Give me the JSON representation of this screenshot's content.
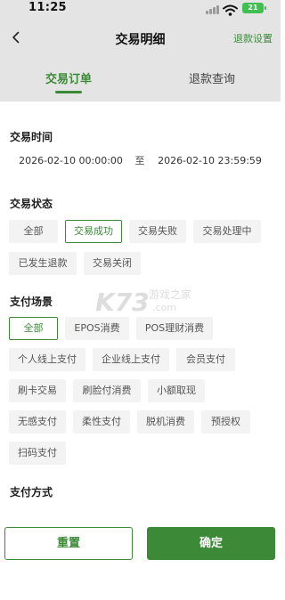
{
  "status_bar": {
    "time": "11:25",
    "battery": "21",
    "battery_color": "#3fbf4f"
  },
  "nav": {
    "title": "交易明细",
    "action_label": "退款设置",
    "back_icon": "chevron-left-icon"
  },
  "tabs": [
    {
      "label": "交易订单",
      "selected": true
    },
    {
      "label": "退款查询",
      "selected": false
    }
  ],
  "filter": {
    "time": {
      "title": "交易时间",
      "start": "2026-02-10 00:00:00",
      "separator": "至",
      "end": "2026-02-10 23:59:59"
    },
    "status": {
      "title": "交易状态",
      "options": [
        "全部",
        "交易成功",
        "交易失败",
        "交易处理中",
        "已发生退款",
        "交易关闭"
      ],
      "selected": "交易成功"
    },
    "scene": {
      "title": "支付场景",
      "options": [
        "全部",
        "EPOS消费",
        "POS理财消费",
        "个人线上支付",
        "企业线上支付",
        "会员支付",
        "刷卡交易",
        "刷脸付消费",
        "小额取现",
        "无感支付",
        "柔性支付",
        "脱机消费",
        "预授权",
        "扫码支付"
      ],
      "selected": "全部"
    },
    "method": {
      "title": "支付方式"
    }
  },
  "watermark": {
    "text_top": "游戏之家",
    "text_bottom": ".com"
  },
  "buttons": {
    "reset": "重置",
    "confirm": "确定"
  },
  "colors": {
    "accent": "#3c8a38",
    "overlay": "#e4e4e4",
    "chip_bg": "#f3f3f3"
  }
}
